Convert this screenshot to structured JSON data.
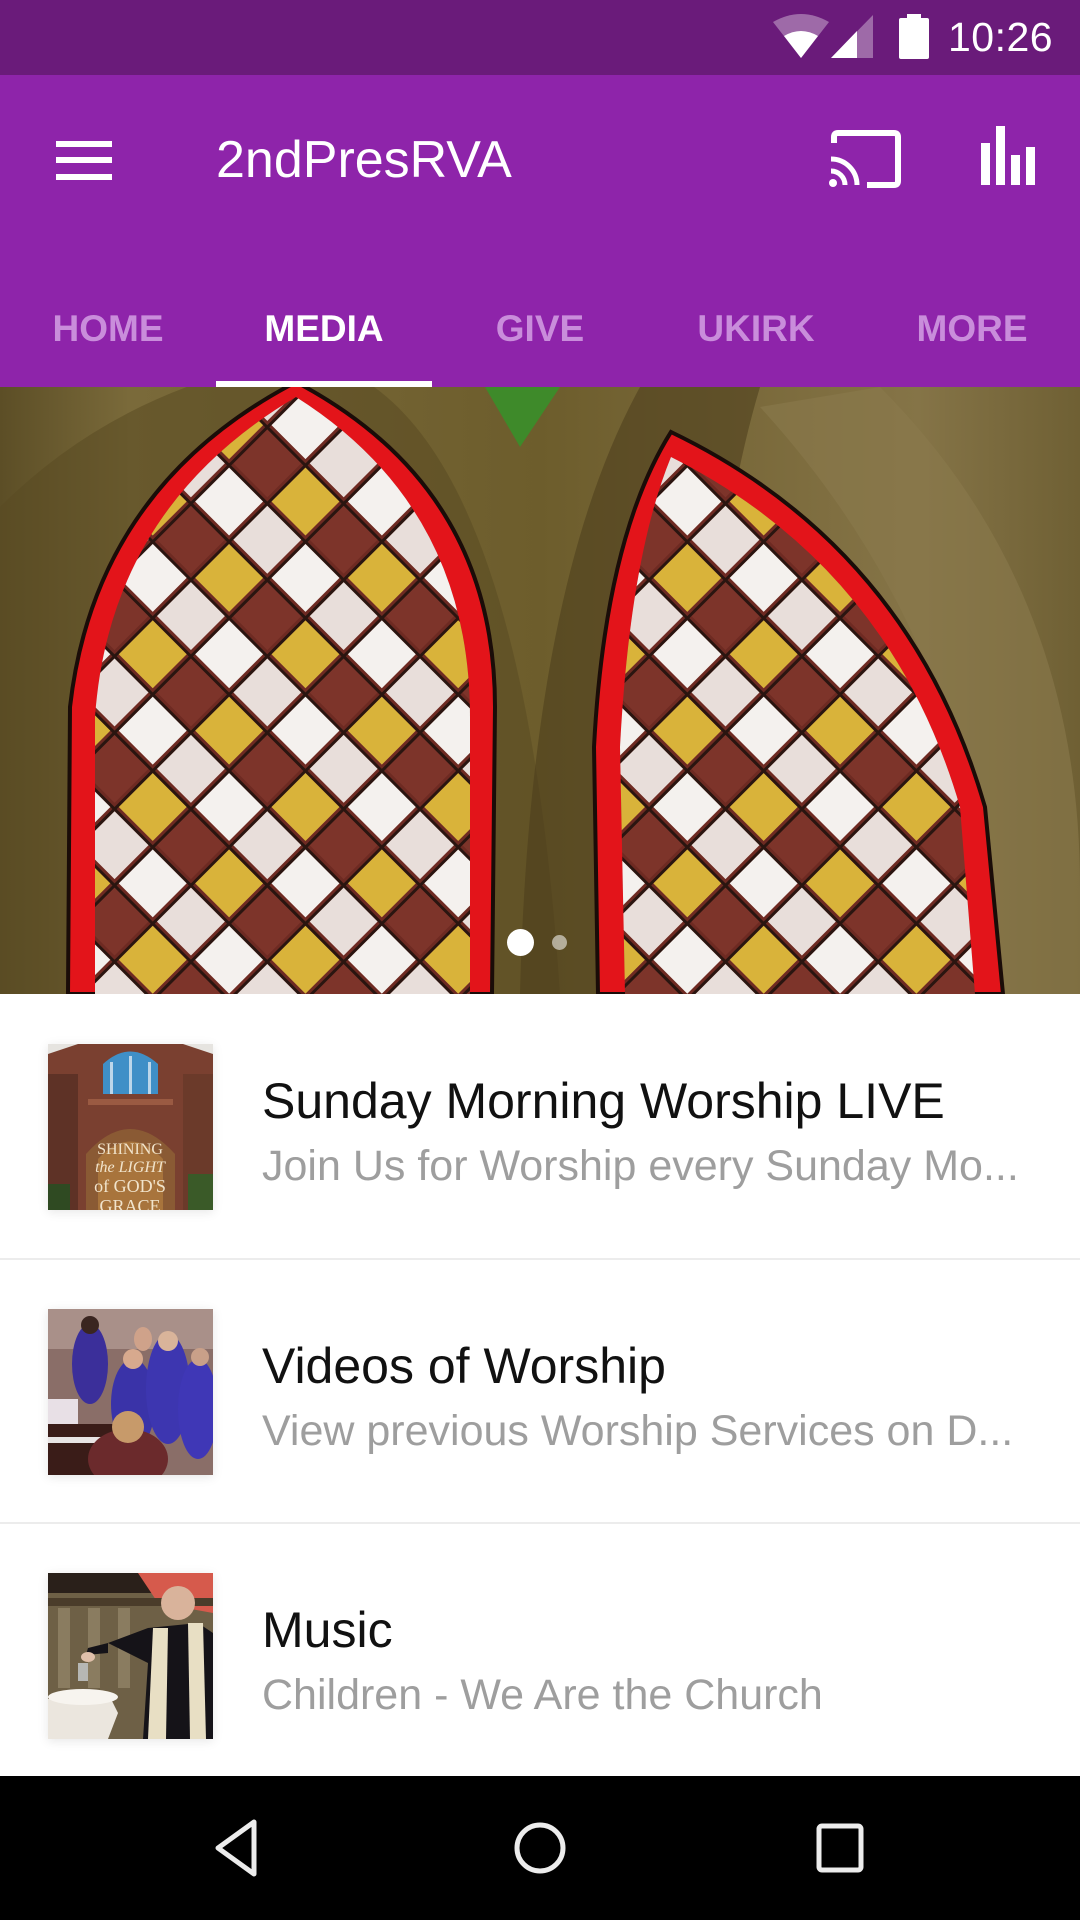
{
  "status_bar": {
    "time": "10:26",
    "icons": [
      "wifi-icon",
      "cell-signal-icon",
      "battery-icon"
    ]
  },
  "app_bar": {
    "title": "2ndPresRVA",
    "background_color": "#8e24aa",
    "status_bar_color": "#6a1b7a",
    "icons": {
      "menu": "hamburger-menu-icon",
      "cast": "cast-icon",
      "stats": "bar-chart-icon"
    }
  },
  "tabs": [
    {
      "label": "HOME",
      "active": false
    },
    {
      "label": "MEDIA",
      "active": true
    },
    {
      "label": "GIVE",
      "active": false
    },
    {
      "label": "UKIRK",
      "active": false
    },
    {
      "label": "MORE",
      "active": false
    }
  ],
  "hero": {
    "description": "Stained glass gothic windows",
    "pages": 2,
    "current_page": 1
  },
  "media_list": [
    {
      "title": "Sunday Morning Worship LIVE",
      "subtitle": "Join Us for Worship every Sunday Mo...",
      "thumbnail": "church-facade",
      "thumbnail_text": "SHINING the LIGHT of GOD'S GRACE"
    },
    {
      "title": "Videos of Worship",
      "subtitle": "View previous Worship Services on D...",
      "thumbnail": "childrens-choir"
    },
    {
      "title": "Music",
      "subtitle": "Children - We Are the Church",
      "thumbnail": "baptism-font"
    }
  ],
  "nav_bar": {
    "buttons": [
      "back-icon",
      "home-icon",
      "recents-icon"
    ]
  }
}
